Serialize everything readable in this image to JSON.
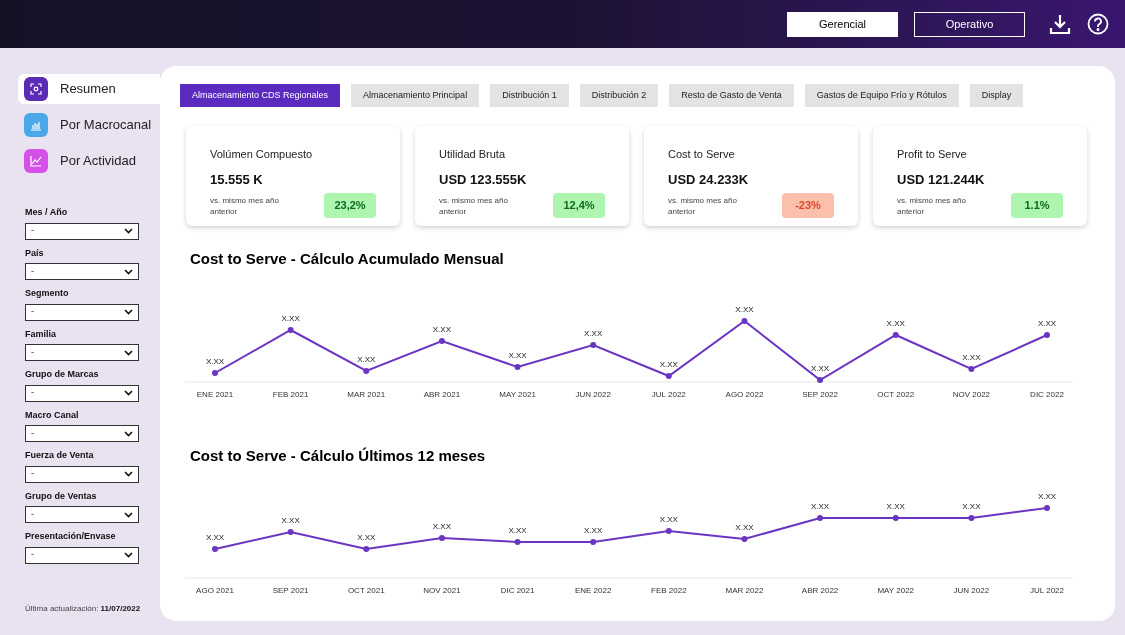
{
  "header": {
    "view_buttons": [
      {
        "label": "Gerencial",
        "selected": true
      },
      {
        "label": "Operativo",
        "selected": false
      }
    ]
  },
  "sidebar": {
    "nav": [
      {
        "label": "Resumen",
        "selected": true,
        "color": "#5b2bb5",
        "kind": "scan"
      },
      {
        "label": "Por Macrocanal",
        "selected": false,
        "color": "#4aa8e8",
        "kind": "bars"
      },
      {
        "label": "Por Actividad",
        "selected": false,
        "color": "#d450e6",
        "kind": "line"
      }
    ],
    "filters": [
      {
        "label": "Mes / Año",
        "value": "-"
      },
      {
        "label": "País",
        "value": "-"
      },
      {
        "label": "Segmento",
        "value": "-"
      },
      {
        "label": "Familia",
        "value": "-"
      },
      {
        "label": "Grupo de Marcas",
        "value": "-"
      },
      {
        "label": "Macro Canal",
        "value": "-"
      },
      {
        "label": "Fuerza de Venta",
        "value": "-"
      },
      {
        "label": "Grupo de Ventas",
        "value": "-"
      },
      {
        "label": "Presentación/Envase",
        "value": "-"
      }
    ],
    "last_update": {
      "label": "Última actualización:",
      "date": "11/07/2022"
    }
  },
  "tabs": [
    {
      "label": "Almacenamiento CDS Regionales",
      "selected": true
    },
    {
      "label": "Almacenamiento Principal",
      "selected": false
    },
    {
      "label": "Distribución 1",
      "selected": false
    },
    {
      "label": "Distribución 2",
      "selected": false
    },
    {
      "label": "Resto de Gasto de Venta",
      "selected": false
    },
    {
      "label": "Gastos de Equipo Frío y Rótulos",
      "selected": false
    },
    {
      "label": "Display",
      "selected": false
    }
  ],
  "kpis": [
    {
      "title": "Volúmen Compuesto",
      "value": "15.555 K",
      "note": "vs. mismo mes año anterior",
      "change": "23,2%",
      "kind": "positive"
    },
    {
      "title": "Utilidad Bruta",
      "value": "USD 123.555K",
      "note": "vs. mismo mes año anterior",
      "change": "12,4%",
      "kind": "positive"
    },
    {
      "title": "Cost to Serve",
      "value": "USD 24.233K",
      "note": "vs. mismo mes año anterior",
      "change": "-23%",
      "kind": "negative"
    },
    {
      "title": "Profit to Serve",
      "value": "USD 121.244K",
      "note": "vs. mismo mes año anterior",
      "change": "1.1%",
      "kind": "positive"
    }
  ],
  "charts": [
    {
      "title": "Cost to Serve - Cálculo Acumulado  Mensual",
      "points": [
        {
          "category": "ENE 2021",
          "value_label": "X.XX"
        },
        {
          "category": "FEB 2021",
          "value_label": "X.XX"
        },
        {
          "category": "MAR 2021",
          "value_label": "X.XX"
        },
        {
          "category": "ABR 2021",
          "value_label": "X.XX"
        },
        {
          "category": "MAY 2021",
          "value_label": "X.XX"
        },
        {
          "category": "JUN 2022",
          "value_label": "X.XX"
        },
        {
          "category": "JUL 2022",
          "value_label": "X.XX"
        },
        {
          "category": "AGO 2022",
          "value_label": "X.XX"
        },
        {
          "category": "SEP 2022",
          "value_label": "X.XX"
        },
        {
          "category": "OCT 2022",
          "value_label": "X.XX"
        },
        {
          "category": "NOV 2022",
          "value_label": "X.XX"
        },
        {
          "category": "DIC 2022",
          "value_label": "X.XX"
        }
      ]
    },
    {
      "title": "Cost to Serve - Cálculo Últimos 12 meses",
      "points": [
        {
          "category": "AGO 2021",
          "value_label": "X.XX"
        },
        {
          "category": "SEP 2021",
          "value_label": "X.XX"
        },
        {
          "category": "OCT 2021",
          "value_label": "X.XX"
        },
        {
          "category": "NOV 2021",
          "value_label": "X.XX"
        },
        {
          "category": "DIC 2021",
          "value_label": "X.XX"
        },
        {
          "category": "ENE 2022",
          "value_label": "X.XX"
        },
        {
          "category": "FEB 2022",
          "value_label": "X.XX"
        },
        {
          "category": "MAR 2022",
          "value_label": "X.XX"
        },
        {
          "category": "ABR 2022",
          "value_label": "X.XX"
        },
        {
          "category": "MAY 2022",
          "value_label": "X.XX"
        },
        {
          "category": "JUN 2022",
          "value_label": "X.XX"
        },
        {
          "category": "JUL 2022",
          "value_label": "X.XX"
        }
      ]
    }
  ]
}
